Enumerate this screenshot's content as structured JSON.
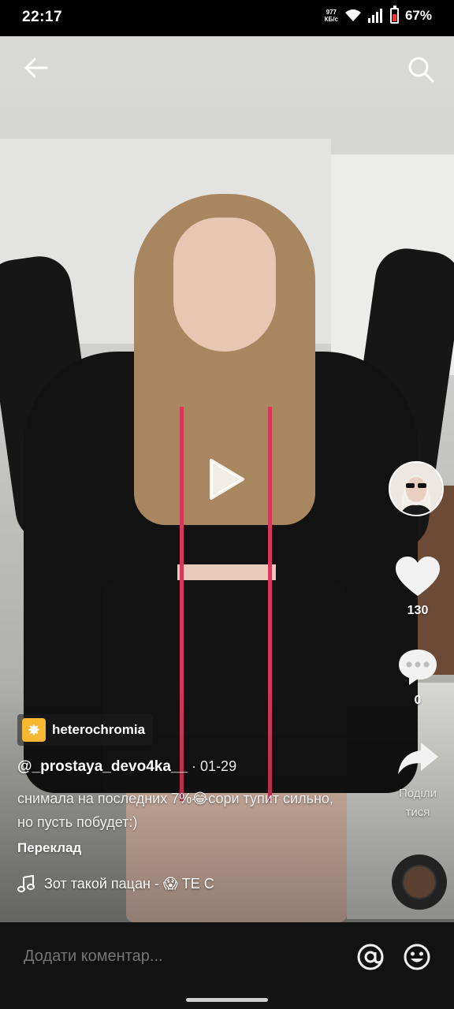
{
  "status_bar": {
    "time": "22:17",
    "net_speed_value": "977",
    "net_speed_unit": "КБ/с",
    "battery_percent": "67%",
    "battery_level": 0.67
  },
  "video": {
    "is_paused": true
  },
  "sidebar": {
    "likes": "130",
    "comments": "0",
    "share_label_line1": "Поділи",
    "share_label_line2": "тися"
  },
  "caption": {
    "effect_name": "heterochromia",
    "username": "@_prostaya_devo4ka__",
    "date": " · 01-29",
    "description": "снимала на последних 7%😂сори тупит сильно, но пусть побудет:)",
    "translate_label": "Переклад",
    "music": "Зот такой пацан - 😱 TE C"
  },
  "comment_bar": {
    "placeholder": "Додати коментар..."
  },
  "colors": {
    "accent_red": "#d8365a",
    "effect_tag": "#f7b733"
  }
}
